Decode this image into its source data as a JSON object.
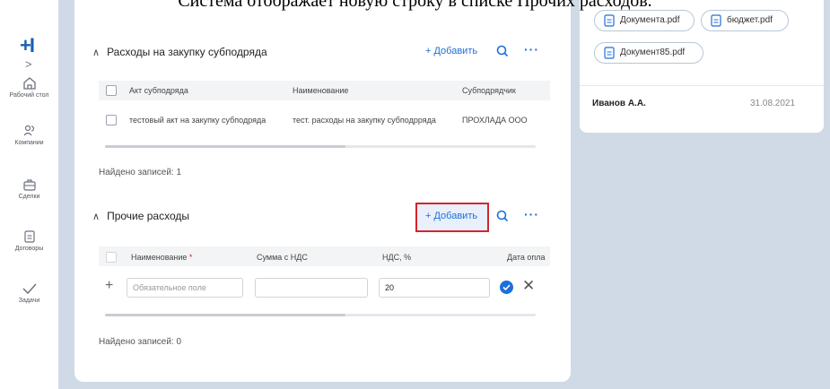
{
  "caption": "Система отображает новую строку в списке Прочих расходов.",
  "nav": {
    "logo": "+I",
    "items": [
      {
        "label": "Рабочий стол"
      },
      {
        "label": "Компании"
      },
      {
        "label": "Сделки"
      },
      {
        "label": "Договоры"
      },
      {
        "label": "Задачи"
      }
    ]
  },
  "section1": {
    "title": "Расходы на закупку субподряда",
    "add_label": "+ Добавить",
    "columns": [
      "Акт субподряда",
      "Наименование",
      "Субподрядчик"
    ],
    "row": [
      "тестовый акт на закупку субподряда",
      "тест. расходы на закупку субподрряда",
      "ПРОХЛАДА ООО"
    ],
    "found": "Найдено записей: 1"
  },
  "section2": {
    "title": "Прочие расходы",
    "add_label": "+ Добавить",
    "columns": [
      "Наименование",
      "*",
      "Сумма с НДС",
      "НДС, %",
      "Дата опла"
    ],
    "name_placeholder": "Обязательное поле",
    "sum_value": "",
    "vat_value": "20",
    "found": "Найдено записей: 0"
  },
  "right": {
    "files": [
      "Документа.pdf",
      "бюджет.pdf",
      "Документ85.pdf"
    ],
    "user": "Иванов А.А.",
    "date": "31.08.2021"
  },
  "colors": {
    "accent": "#1d6fd8",
    "highlight": "#d6242b",
    "background": "#cfdae6"
  }
}
